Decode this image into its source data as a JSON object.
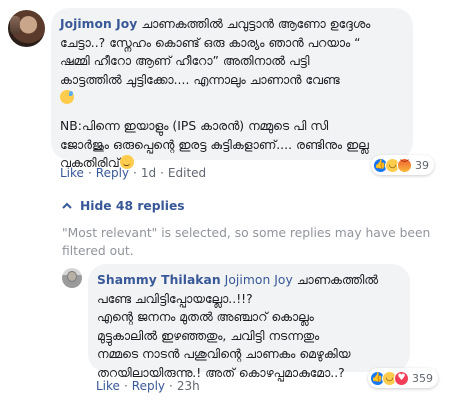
{
  "comment1": {
    "author": "Jojimon Joy",
    "lines": [
      "ചാണകത്തിൽ ചവുട്ടാൻ ആണോ ഉദ്ദേശം",
      "ചേട്ടാ..? സ്നേഹം കൊണ്ട് ഒരു കാര്യം ഞാൻ പറയാം “",
      "ഷമ്മി ഹീറോ ആണ് ഹീറോ” അതിനാൽ പട്ടി",
      "കാട്ടത്തിൽ ചുട്ടിക്കോ.... എന്നാലും ചാണാൻ വേണ്ട"
    ],
    "emoji_line1": "sweat-smile-emoji",
    "lines_2": [
      "NB:പിന്നെ ഇയാളും (IPS കാരൻ) നമ്മുടെ പി സി",
      "ജോർജും ഒരുപ്പെന്റെ ഇരട്ട കുട്ടികളാണ്.... രണ്ടിനും ഇല്ല",
      "വകതിരിവ്"
    ],
    "emoji_line2": "smirk-emoji",
    "reactions": {
      "icons": [
        "like",
        "haha",
        "angry"
      ],
      "count": "39"
    },
    "actions": {
      "like": "Like",
      "reply": "Reply",
      "time": "1d",
      "edited": "Edited"
    }
  },
  "hide_replies": {
    "label": "Hide 48 replies"
  },
  "notice": "\"Most relevant\" is selected, so some replies may have been filtered out.",
  "comment2": {
    "author": "Shammy Thilakan",
    "mention": "Jojimon Joy",
    "first_text": " ചാണകത്തിൽ",
    "lines": [
      "പണ്ടേ ചവിട്ടിപ്പോയല്ലോ..!!?",
      "എന്റെ ജനനം മുതൽ അഞ്ചാറ് കൊല്ലം",
      "മുട്ടുകാലിൽ ഇഴഞ്ഞതും, ചവിട്ടി നടന്നതും",
      "നമ്മടെ നാടൻ പശുവിന്റെ ചാണകം മെഴുകിയ",
      "തറയിലായിരുന്നു.! അത് കൊഴപ്പമാകുമോ..?"
    ],
    "reactions": {
      "icons": [
        "like",
        "haha",
        "love"
      ],
      "count": "359"
    },
    "actions": {
      "like": "Like",
      "reply": "Reply",
      "time": "23h"
    }
  }
}
